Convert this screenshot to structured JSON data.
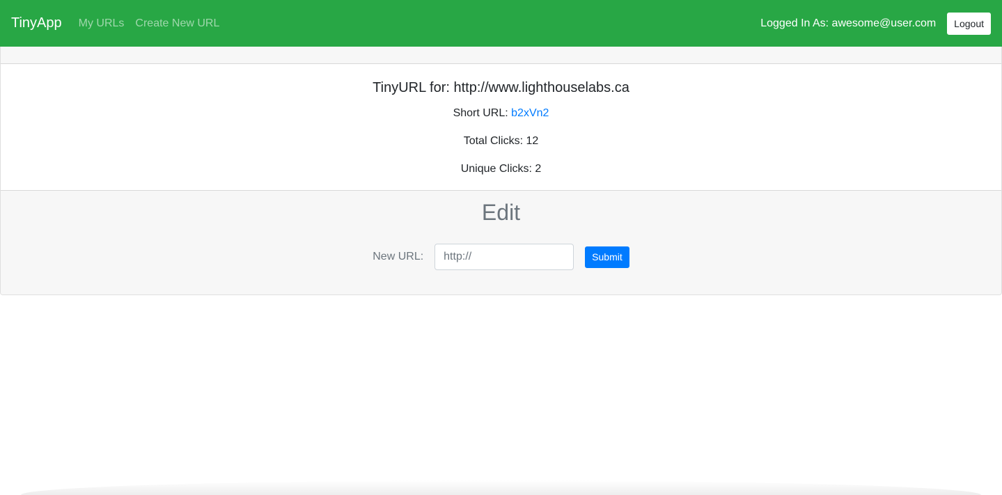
{
  "navbar": {
    "brand": "TinyApp",
    "links": [
      "My URLs",
      "Create New URL"
    ],
    "logged_in_text": "Logged In As: awesome@user.com",
    "logout_label": "Logout"
  },
  "url_card": {
    "title": "TinyURL for: http://www.lighthouselabs.ca",
    "short_url_label": "Short URL: ",
    "short_url_value": "b2xVn2",
    "total_clicks": "Total Clicks: 12",
    "unique_clicks": "Unique Clicks: 2"
  },
  "edit": {
    "title": "Edit",
    "label": "New URL:",
    "input_placeholder": "http://",
    "submit_label": "Submit"
  },
  "colors": {
    "navbar_bg": "#28a745",
    "link": "#007bff",
    "primary_button": "#007bff"
  }
}
